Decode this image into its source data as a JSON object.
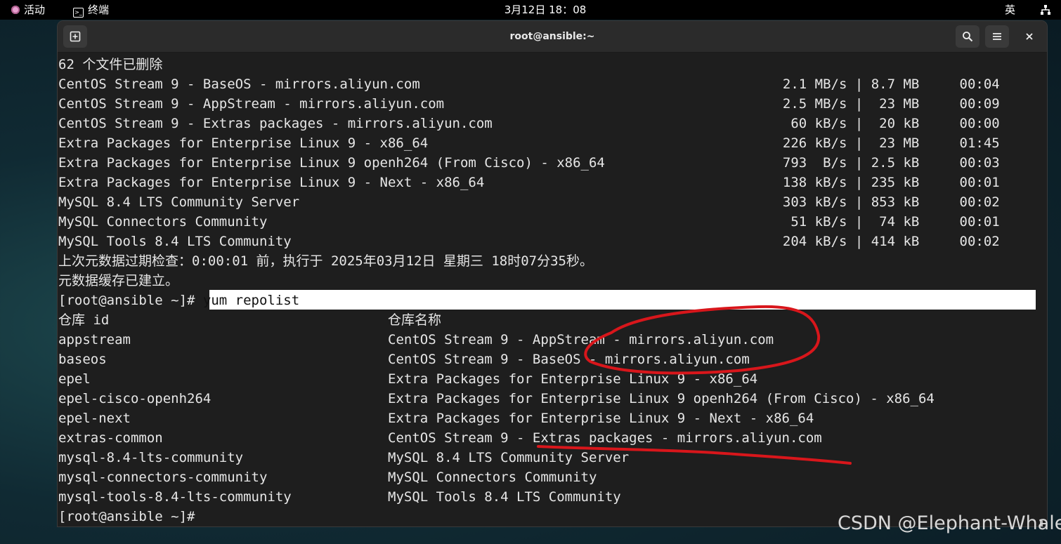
{
  "topbar": {
    "activities": "活动",
    "app": "终端",
    "clock": "3月12日 18：08",
    "ime": "英",
    "network_icon": "network-icon"
  },
  "window": {
    "title": "root@ansible:~",
    "new_tab_icon": "new-tab-icon",
    "search_icon": "search-icon",
    "menu_icon": "hamburger-menu-icon",
    "close_icon": "close-icon"
  },
  "terminal": {
    "removed_line": "62 个文件已删除",
    "downloads": [
      {
        "name": "CentOS Stream 9 - BaseOS - mirrors.aliyun.com",
        "stat": "  2.1 MB/s | 8.7 MB     00:04"
      },
      {
        "name": "CentOS Stream 9 - AppStream - mirrors.aliyun.com",
        "stat": "  2.5 MB/s |  23 MB     00:09"
      },
      {
        "name": "CentOS Stream 9 - Extras packages - mirrors.aliyun.com",
        "stat": "   60 kB/s |  20 kB     00:00"
      },
      {
        "name": "Extra Packages for Enterprise Linux 9 - x86_64",
        "stat": "  226 kB/s |  23 MB     01:45"
      },
      {
        "name": "Extra Packages for Enterprise Linux 9 openh264 (From Cisco) - x86_64",
        "stat": "  793  B/s | 2.5 kB     00:03"
      },
      {
        "name": "Extra Packages for Enterprise Linux 9 - Next - x86_64",
        "stat": "  138 kB/s | 235 kB     00:01"
      },
      {
        "name": "MySQL 8.4 LTS Community Server",
        "stat": "  303 kB/s | 853 kB     00:02"
      },
      {
        "name": "MySQL Connectors Community",
        "stat": "   51 kB/s |  74 kB     00:01"
      },
      {
        "name": "MySQL Tools 8.4 LTS Community",
        "stat": "  204 kB/s | 414 kB     00:02"
      }
    ],
    "metadata_check": "上次元数据过期检查：0:00:01 前，执行于 2025年03月12日 星期三 18时07分35秒。",
    "metadata_cache": "元数据缓存已建立。",
    "prompt": "[root@ansible ~]# ",
    "command": "yum repolist",
    "repo_header": {
      "id": "仓库 id",
      "name": "仓库名称"
    },
    "repos": [
      {
        "id": "appstream",
        "name": "CentOS Stream 9 - AppStream - mirrors.aliyun.com"
      },
      {
        "id": "baseos",
        "name": "CentOS Stream 9 - BaseOS - mirrors.aliyun.com"
      },
      {
        "id": "epel",
        "name": "Extra Packages for Enterprise Linux 9 - x86_64"
      },
      {
        "id": "epel-cisco-openh264",
        "name": "Extra Packages for Enterprise Linux 9 openh264 (From Cisco) - x86_64"
      },
      {
        "id": "epel-next",
        "name": "Extra Packages for Enterprise Linux 9 - Next - x86_64"
      },
      {
        "id": "extras-common",
        "name": "CentOS Stream 9 - Extras packages - mirrors.aliyun.com"
      },
      {
        "id": "mysql-8.4-lts-community",
        "name": "MySQL 8.4 LTS Community Server"
      },
      {
        "id": "mysql-connectors-community",
        "name": "MySQL Connectors Community"
      },
      {
        "id": "mysql-tools-8.4-lts-community",
        "name": "MySQL Tools 8.4 LTS Community"
      }
    ],
    "final_prompt": "[root@ansible ~]#"
  },
  "watermark": "CSDN @Elephant-Whale",
  "colors": {
    "annotation": "#d8161b",
    "terminal_bg": "#1e1e1e"
  }
}
